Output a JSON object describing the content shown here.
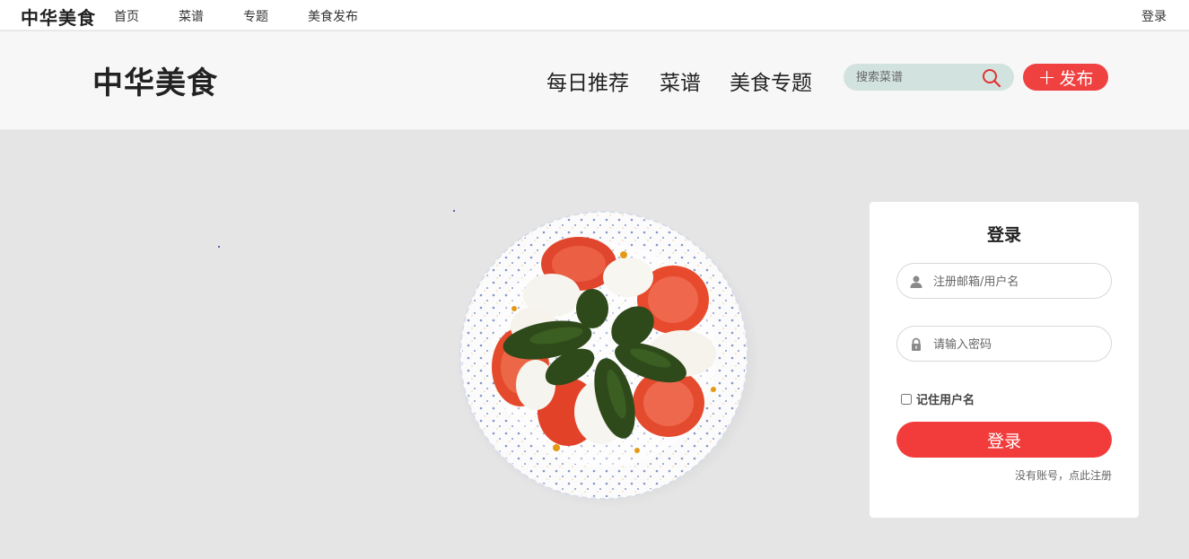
{
  "topbar": {
    "brand": "中华美食",
    "nav": [
      {
        "label": "首页"
      },
      {
        "label": "菜谱"
      },
      {
        "label": "专题"
      },
      {
        "label": "美食发布"
      }
    ],
    "login_label": "登录"
  },
  "header": {
    "logo": "中华美食",
    "nav": [
      {
        "label": "每日推荐"
      },
      {
        "label": "菜谱"
      },
      {
        "label": "美食专题"
      }
    ],
    "search": {
      "placeholder": "搜索菜谱",
      "icon": "search-icon"
    },
    "publish_label": "发布"
  },
  "login_card": {
    "title": "登录",
    "username_placeholder": "注册邮箱/用户名",
    "password_placeholder": "请输入密码",
    "remember_label": "记住用户名",
    "submit_label": "登录",
    "register_link": "没有账号，点此注册"
  },
  "colors": {
    "accent": "#f04141",
    "search_bg": "#d2e3df",
    "hero_bg": "#e5e5e5"
  }
}
